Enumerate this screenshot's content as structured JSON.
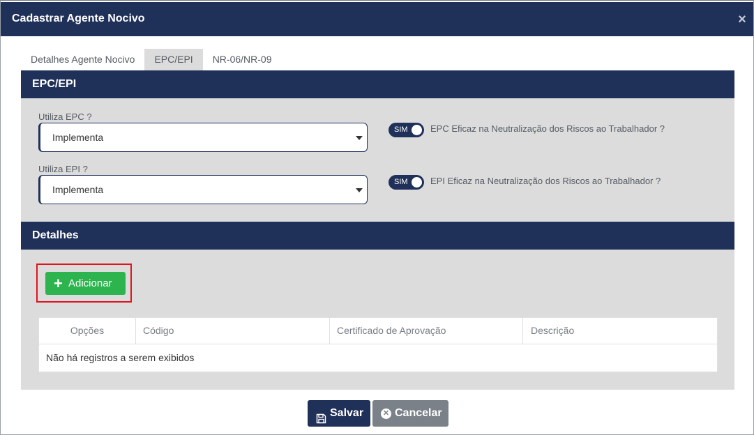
{
  "modal": {
    "title": "Cadastrar Agente Nocivo",
    "close": "×"
  },
  "tabs": [
    {
      "label": "Detalhes Agente Nocivo",
      "active": false
    },
    {
      "label": "EPC/EPI",
      "active": true
    },
    {
      "label": "NR-06/NR-09",
      "active": false
    }
  ],
  "epc_section": {
    "title": "EPC/EPI",
    "epc_label": "Utiliza EPC ?",
    "epc_value": "Implementa",
    "epc_toggle": "SIM",
    "epc_toggle_text": "EPC Eficaz na Neutralização dos Riscos ao Trabalhador ?",
    "epi_label": "Utiliza EPI ?",
    "epi_value": "Implementa",
    "epi_toggle": "SIM",
    "epi_toggle_text": "EPI Eficaz na Neutralização dos Riscos ao Trabalhador ?"
  },
  "details_section": {
    "title": "Detalhes",
    "add_label": "Adicionar",
    "columns": [
      "Opções",
      "Código",
      "Certificado de Aprovação",
      "Descrição"
    ],
    "empty_message": "Não há registros a serem exibidos"
  },
  "footer": {
    "save_label": "Salvar",
    "cancel_label": "Cancelar"
  },
  "colors": {
    "primary": "#1f3059",
    "success": "#2db44f",
    "secondary": "#7b8189",
    "highlight": "#e0141c"
  }
}
